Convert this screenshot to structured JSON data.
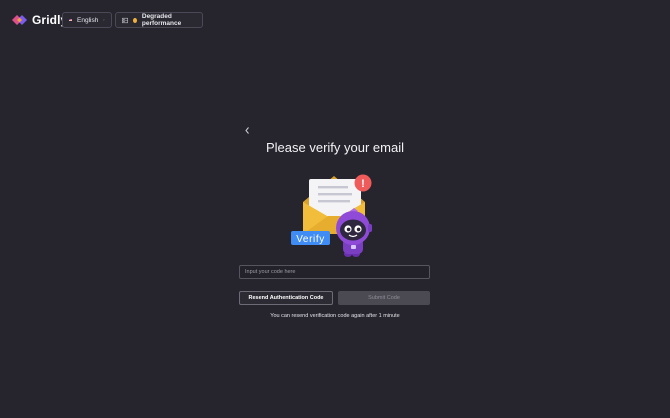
{
  "header": {
    "logo_text": "Gridly",
    "language": "English",
    "status": "Degraded performance",
    "icons": [
      "gridly-logo-icon",
      "us-flag-icon",
      "chevron-down-icon",
      "status-page-icon",
      "status-dot-icon"
    ]
  },
  "main": {
    "back_icon": "chevron-left-icon",
    "title": "Please verify your email",
    "illustration_label": "Verify",
    "alert_symbol": "!",
    "input": {
      "placeholder": "Input your code here",
      "value": ""
    },
    "resend_label": "Resend Authentication Code",
    "submit_label": "Submit Code",
    "hint": "You can resend verification code again after 1 minute"
  },
  "colors": {
    "background": "#26252e",
    "envelope": "#f1bd3a",
    "verify_tag": "#3f8cf5",
    "robot": "#7a3ec2",
    "alert": "#ef5b5b",
    "status_dot": "#f2b03a"
  }
}
